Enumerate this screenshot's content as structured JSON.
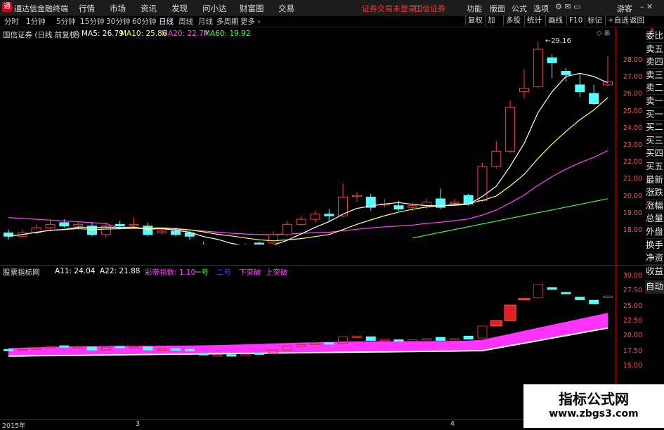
{
  "app": {
    "title": "通达信金融终端",
    "logo": "通"
  },
  "menu": [
    "行情",
    "市场",
    "资讯",
    "发现",
    "问小达",
    "财富圈",
    "交易"
  ],
  "warnings": [
    "证券交易未登录",
    "国信证券"
  ],
  "top_tools": [
    "功能",
    "版面",
    "公式",
    "选项"
  ],
  "guest": "游客",
  "periods": [
    "分时",
    "1分钟",
    "5分钟",
    "15分钟",
    "30分钟",
    "60分钟",
    "日线",
    "周线",
    "月线",
    "多周期",
    "更多 ›"
  ],
  "active_period": "日线",
  "tool_buttons": [
    "复权",
    "加",
    "多股",
    "统计",
    "画线",
    "F10",
    "标记",
    "+自选",
    "返回"
  ],
  "stock_label": "国信证券 (日线 前复权)",
  "ma_legend": [
    {
      "label": "MA5: 26.79",
      "color": "#ffffff"
    },
    {
      "label": "MA10: 25.86",
      "color": "#ffff66"
    },
    {
      "label": "MA20: 22.74",
      "color": "#ff44ff"
    },
    {
      "label": "MA60: 19.92",
      "color": "#44ff44"
    }
  ],
  "right_panel": [
    "委比",
    "卖五",
    "卖四",
    "卖三",
    "卖二",
    "卖一",
    "买一",
    "买二",
    "买三",
    "买四",
    "买五",
    "最新",
    "涨跌",
    "涨幅",
    "总量",
    "外盘",
    "换手",
    "净资",
    "收益",
    "自动"
  ],
  "corner_label": "R",
  "price_axis": [
    "28.00",
    "27.00",
    "26.00",
    "25.00",
    "24.00",
    "23.00",
    "22.00",
    "21.00",
    "20.00",
    "19.00",
    "18.00"
  ],
  "indicator_legend": [
    {
      "label": "股票指标网",
      "color": "#dddddd"
    },
    {
      "label": "A11: 24.04",
      "color": "#ffffff"
    },
    {
      "label": "A22: 21.88",
      "color": "#ffffff"
    },
    {
      "label": "彩带指数: 1.10",
      "color": "#ff44ff"
    },
    {
      "label": "一号",
      "color": "#44ff44"
    },
    {
      "label": "二号",
      "color": "#4444ff"
    },
    {
      "label": "下突破",
      "color": "#ff44ff"
    },
    {
      "label": "上突破",
      "color": "#ff44ff"
    }
  ],
  "sub_axis": [
    "30.00",
    "27.50",
    "25.00",
    "22.50",
    "20.00",
    "17.50",
    "15.00"
  ],
  "dates": [
    "2015年",
    "3",
    "4"
  ],
  "annotations": {
    "high": "29.16",
    "low": "16.60"
  },
  "watermark": {
    "line1": "指标公式网",
    "line2": "www.zbgs3.com"
  },
  "chart_data": {
    "type": "candlestick",
    "title": "国信证券 (日线 前复权)",
    "ylim": [
      17.0,
      29.5
    ],
    "candles": [
      {
        "o": 17.9,
        "c": 17.7,
        "h": 18.1,
        "l": 17.5
      },
      {
        "o": 17.7,
        "c": 17.9,
        "h": 18.1,
        "l": 17.6
      },
      {
        "o": 17.9,
        "c": 18.2,
        "h": 18.4,
        "l": 17.8
      },
      {
        "o": 18.2,
        "c": 18.4,
        "h": 18.7,
        "l": 18.0
      },
      {
        "o": 18.5,
        "c": 18.3,
        "h": 18.7,
        "l": 18.2
      },
      {
        "o": 18.3,
        "c": 18.4,
        "h": 18.6,
        "l": 18.1
      },
      {
        "o": 18.3,
        "c": 17.8,
        "h": 18.5,
        "l": 17.7
      },
      {
        "o": 17.8,
        "c": 18.3,
        "h": 18.5,
        "l": 17.6
      },
      {
        "o": 18.4,
        "c": 18.3,
        "h": 18.6,
        "l": 18.1
      },
      {
        "o": 18.4,
        "c": 18.4,
        "h": 18.8,
        "l": 18.2
      },
      {
        "o": 18.3,
        "c": 17.8,
        "h": 18.5,
        "l": 17.7
      },
      {
        "o": 17.9,
        "c": 18.0,
        "h": 18.2,
        "l": 17.8
      },
      {
        "o": 18.0,
        "c": 17.8,
        "h": 18.2,
        "l": 17.7
      },
      {
        "o": 17.9,
        "c": 17.7,
        "h": 18.0,
        "l": 17.5
      },
      {
        "o": 17.2,
        "c": 17.1,
        "h": 17.4,
        "l": 16.8
      },
      {
        "o": 16.9,
        "c": 17.0,
        "h": 17.2,
        "l": 16.6
      },
      {
        "o": 17.0,
        "c": 16.8,
        "h": 17.1,
        "l": 16.7
      },
      {
        "o": 16.9,
        "c": 17.1,
        "h": 17.3,
        "l": 16.8
      },
      {
        "o": 17.3,
        "c": 17.2,
        "h": 17.4,
        "l": 17.0
      },
      {
        "o": 17.3,
        "c": 17.8,
        "h": 18.0,
        "l": 17.2
      },
      {
        "o": 17.8,
        "c": 18.4,
        "h": 18.6,
        "l": 17.7
      },
      {
        "o": 18.4,
        "c": 18.7,
        "h": 18.9,
        "l": 18.3
      },
      {
        "o": 18.7,
        "c": 19.0,
        "h": 19.2,
        "l": 18.5
      },
      {
        "o": 19.0,
        "c": 18.9,
        "h": 19.3,
        "l": 18.6
      },
      {
        "o": 18.9,
        "c": 20.0,
        "h": 20.8,
        "l": 18.8
      },
      {
        "o": 20.1,
        "c": 20.1,
        "h": 20.3,
        "l": 19.7
      },
      {
        "o": 20.0,
        "c": 19.4,
        "h": 20.2,
        "l": 19.2
      },
      {
        "o": 19.6,
        "c": 19.6,
        "h": 19.9,
        "l": 19.4
      },
      {
        "o": 19.5,
        "c": 19.3,
        "h": 19.8,
        "l": 19.2
      },
      {
        "o": 19.4,
        "c": 19.5,
        "h": 19.7,
        "l": 19.2
      },
      {
        "o": 19.5,
        "c": 19.7,
        "h": 19.9,
        "l": 19.3
      },
      {
        "o": 19.9,
        "c": 19.4,
        "h": 20.5,
        "l": 19.3
      },
      {
        "o": 19.7,
        "c": 19.7,
        "h": 19.9,
        "l": 19.5
      },
      {
        "o": 20.1,
        "c": 19.6,
        "h": 20.2,
        "l": 19.5
      },
      {
        "o": 19.8,
        "c": 21.8,
        "h": 22.0,
        "l": 19.7
      },
      {
        "o": 21.8,
        "c": 22.7,
        "h": 23.3,
        "l": 21.7
      },
      {
        "o": 22.7,
        "c": 25.3,
        "h": 25.7,
        "l": 22.6
      },
      {
        "o": 26.2,
        "c": 26.4,
        "h": 27.5,
        "l": 25.8
      },
      {
        "o": 26.5,
        "c": 28.7,
        "h": 29.16,
        "l": 26.4
      },
      {
        "o": 28.2,
        "c": 27.9,
        "h": 28.4,
        "l": 27.0
      },
      {
        "o": 27.4,
        "c": 27.2,
        "h": 27.6,
        "l": 26.8
      },
      {
        "o": 26.6,
        "c": 26.2,
        "h": 27.3,
        "l": 25.9
      },
      {
        "o": 26.1,
        "c": 25.5,
        "h": 26.6,
        "l": 25.4
      },
      {
        "o": 26.6,
        "c": 26.8,
        "h": 28.3,
        "l": 26.5
      }
    ]
  }
}
